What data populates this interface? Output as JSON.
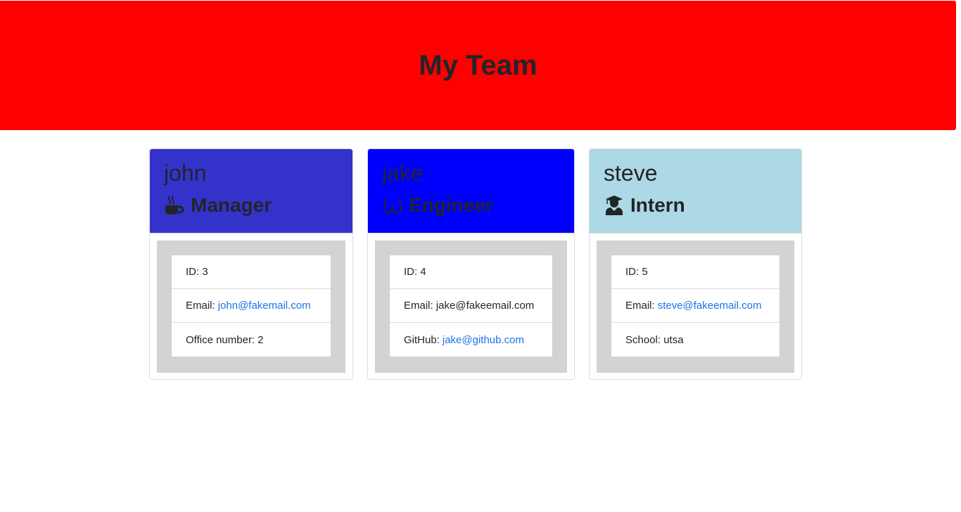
{
  "header": {
    "title": "My Team",
    "bg": "#ff0000"
  },
  "cards": [
    {
      "name": "john",
      "role": "Manager",
      "icon": "coffee-icon",
      "header_bg": "#3333cc",
      "id_label": "ID: 3",
      "email_label": "Email:",
      "email": "john@fakemail.com",
      "extra_label": "Office number: 2"
    },
    {
      "name": "jake",
      "role": "Engineer",
      "icon": "glasses-icon",
      "header_bg": "#0000ff",
      "id_label": "ID: 4",
      "email_label": "Email: jake@fakeemail.com",
      "github_label": "GitHub:",
      "github": "jake@github.com"
    },
    {
      "name": "steve",
      "role": "Intern",
      "icon": "graduate-icon",
      "header_bg": "#add8e6",
      "id_label": "ID: 5",
      "email_label": "Email:",
      "email": "steve@fakeemail.com",
      "extra_label": "School: utsa"
    }
  ]
}
